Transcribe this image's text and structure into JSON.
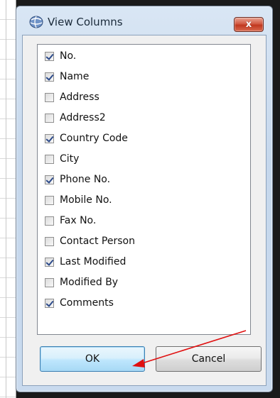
{
  "window": {
    "title": "View Columns",
    "close_label": "x"
  },
  "columns": [
    {
      "label": "No.",
      "checked": true
    },
    {
      "label": "Name",
      "checked": true
    },
    {
      "label": "Address",
      "checked": false
    },
    {
      "label": "Address2",
      "checked": false
    },
    {
      "label": "Country Code",
      "checked": true
    },
    {
      "label": "City",
      "checked": false
    },
    {
      "label": "Phone No.",
      "checked": true
    },
    {
      "label": "Mobile No.",
      "checked": false
    },
    {
      "label": "Fax No.",
      "checked": false
    },
    {
      "label": "Contact Person",
      "checked": false
    },
    {
      "label": "Last Modified",
      "checked": true
    },
    {
      "label": "Modified By",
      "checked": false
    },
    {
      "label": "Comments",
      "checked": true
    }
  ],
  "buttons": {
    "ok_label": "OK",
    "cancel_label": "Cancel"
  },
  "annotation": {
    "arrow_color": "#e01010",
    "arrow_target": "ok-button"
  }
}
